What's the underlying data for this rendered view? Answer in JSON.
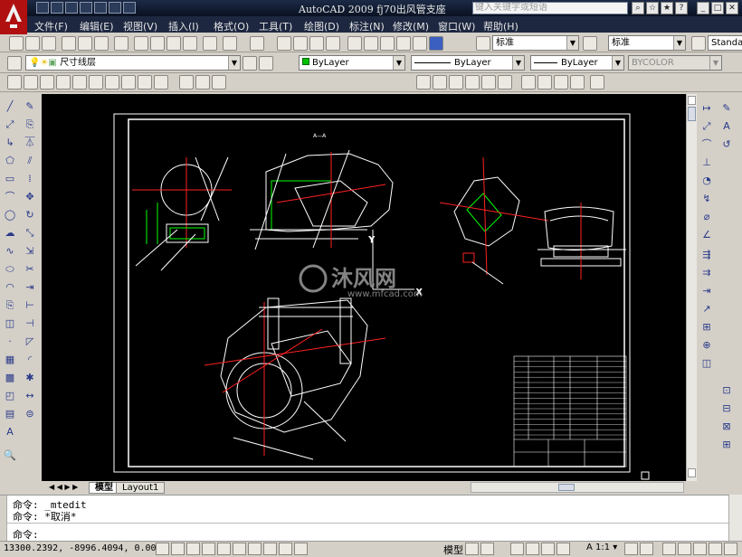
{
  "window": {
    "title": "AutoCAD 2009  fj70出风管支座",
    "help_search_placeholder": "键入关键字或短语"
  },
  "menu": [
    "文件(F)",
    "编辑(E)",
    "视图(V)",
    "插入(I)",
    "格式(O)",
    "工具(T)",
    "绘图(D)",
    "标注(N)",
    "修改(M)",
    "窗口(W)",
    "帮助(H)"
  ],
  "toolbar_styles": {
    "text_style": "标准",
    "dim_style": "标准",
    "table_style": "Standar"
  },
  "layers": {
    "current_layer": "尺寸线层",
    "color": "ByLayer",
    "linetype": "ByLayer",
    "lineweight": "ByLayer",
    "plot_style": "BYCOLOR"
  },
  "tabs": {
    "model": "模型",
    "layout1": "Layout1"
  },
  "command": {
    "line1": "命令:  _mtedit",
    "line2": "命令: *取消*",
    "prompt": "命令:"
  },
  "status": {
    "coordinates": "13300.2392, -8996.4094, 0.0000",
    "model_label": "模型",
    "scale": "1:1"
  },
  "watermark": {
    "brand": "沐风网",
    "url": "www.mfcad.com"
  },
  "colors": {
    "menubar": "#1d2740",
    "canvas": "#000000",
    "geometry_white": "#ffffff",
    "dim_green": "#00ff00",
    "center_red": "#ff2020"
  }
}
